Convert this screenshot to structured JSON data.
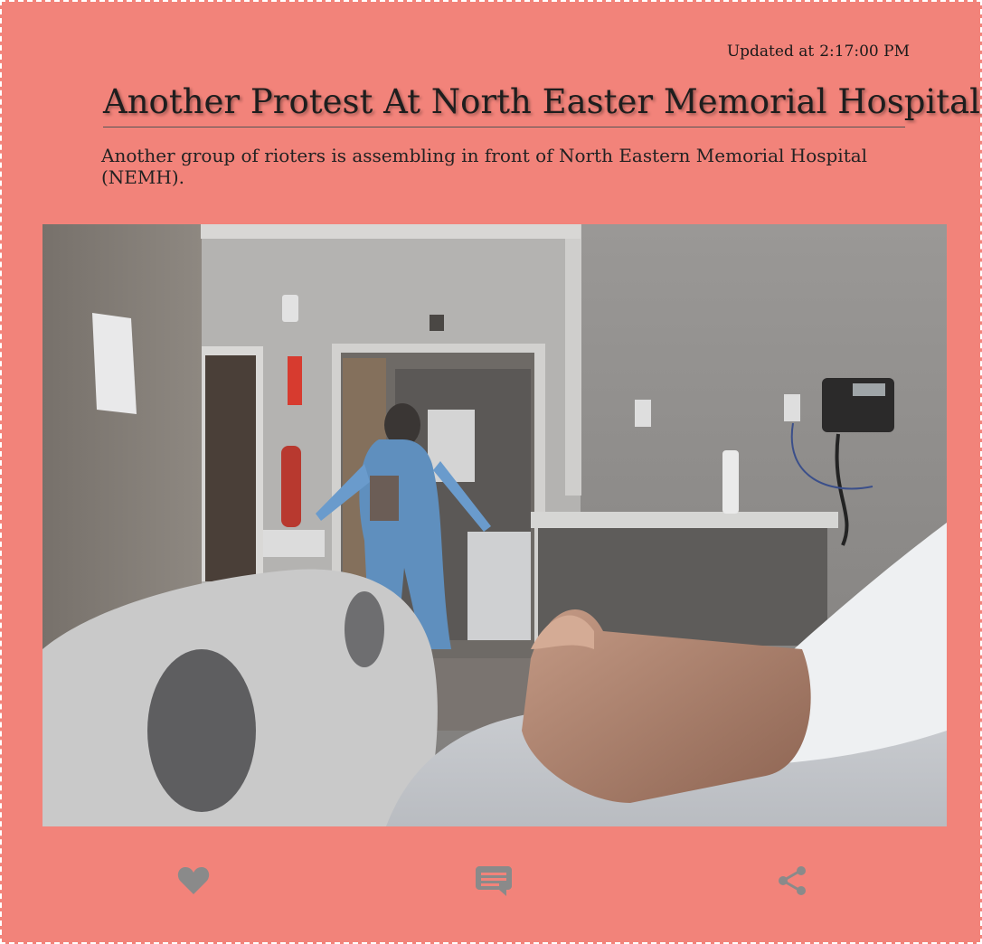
{
  "article": {
    "updated_label": "Updated at",
    "updated_time": "2:17:00 PM",
    "headline": "Another Protest At North Easter Memorial Hospital",
    "summary": "Another group of rioters is assembling in front of North Eastern Memorial Hospital (NEMH)."
  },
  "photo": {
    "description_icon": "hospital-photo"
  },
  "actions": {
    "like_icon": "heart-icon",
    "comment_icon": "comment-icon",
    "share_icon": "share-icon"
  },
  "colors": {
    "card_background": "#f2837a",
    "icon": "#8a8a8a"
  }
}
